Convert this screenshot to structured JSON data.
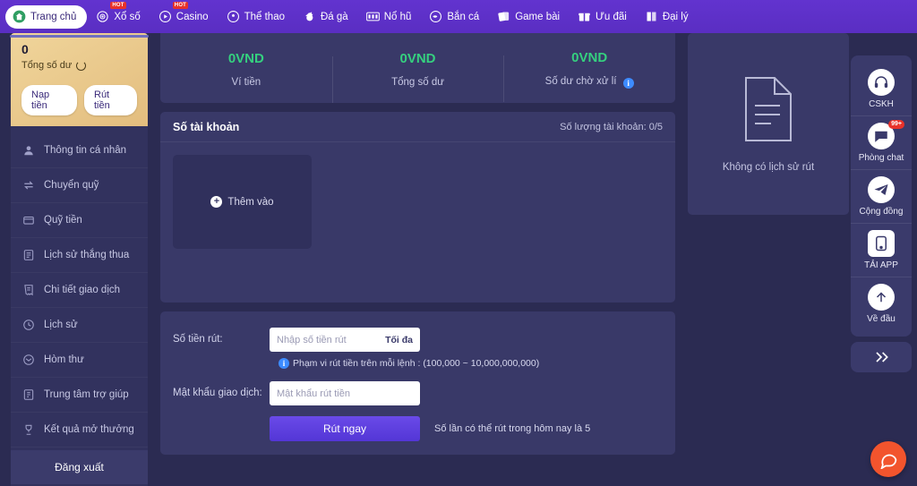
{
  "topnav": {
    "items": [
      {
        "label": "Trang chủ",
        "icon": "home-icon",
        "active": true,
        "badge": ""
      },
      {
        "label": "Xổ số",
        "icon": "target-icon",
        "active": false,
        "badge": "HOT"
      },
      {
        "label": "Casino",
        "icon": "play-circle-icon",
        "active": false,
        "badge": "HOT"
      },
      {
        "label": "Thể thao",
        "icon": "soccer-ball-icon",
        "active": false,
        "badge": ""
      },
      {
        "label": "Đá gà",
        "icon": "rooster-icon",
        "active": false,
        "badge": ""
      },
      {
        "label": "Nổ hũ",
        "icon": "slot-machine-icon",
        "active": false,
        "badge": ""
      },
      {
        "label": "Bắn cá",
        "icon": "fish-icon",
        "active": false,
        "badge": ""
      },
      {
        "label": "Game bài",
        "icon": "cards-icon",
        "active": false,
        "badge": ""
      },
      {
        "label": "Ưu đãi",
        "icon": "gift-icon",
        "active": false,
        "badge": ""
      },
      {
        "label": "Đại lý",
        "icon": "book-icon",
        "active": false,
        "badge": ""
      }
    ]
  },
  "sidebar": {
    "wallet": {
      "amount": "0",
      "label": "Tổng số dư",
      "refresh_icon": "refresh-icon",
      "deposit_label": "Nạp tiền",
      "withdraw_label": "Rút tiền"
    },
    "items": [
      {
        "label": "Thông tin cá nhân",
        "icon": "user-icon"
      },
      {
        "label": "Chuyển quỹ",
        "icon": "transfer-icon"
      },
      {
        "label": "Quỹ tiền",
        "icon": "wallet-icon"
      },
      {
        "label": "Lịch sử thắng thua",
        "icon": "list-icon"
      },
      {
        "label": "Chi tiết giao dịch",
        "icon": "receipt-icon"
      },
      {
        "label": "Lịch sử",
        "icon": "clock-icon"
      },
      {
        "label": "Hòm thư",
        "icon": "mail-icon"
      },
      {
        "label": "Trung tâm trợ giúp",
        "icon": "help-icon"
      },
      {
        "label": "Kết quả mở thưởng",
        "icon": "trophy-icon"
      }
    ],
    "logout_label": "Đăng xuất",
    "logo_name": "mmo-casino-logo"
  },
  "balance_strip": {
    "columns": [
      {
        "value": "0VND",
        "label": "Ví tiền",
        "info": false
      },
      {
        "value": "0VND",
        "label": "Tổng số dư",
        "info": false
      },
      {
        "value": "0VND",
        "label": "Số dư chờ xử lí",
        "info": true
      }
    ]
  },
  "account_panel": {
    "title": "Số tài khoản",
    "count_label": "Số lượng tài khoản:",
    "count_value": "0/5",
    "add_label": "Thêm vào",
    "add_icon": "plus-circle-icon"
  },
  "withdraw_form": {
    "amount_label": "Số tiền rút:",
    "amount_placeholder": "Nhập số tiền rút",
    "max_label": "Tối đa",
    "hint_icon": "info-icon",
    "hint": "Phạm vi rút tiền trên mỗi lệnh : (100,000 ~ 10,000,000,000)",
    "password_label": "Mật khẩu giao dịch:",
    "password_placeholder": "Mật khẩu rút tiền",
    "submit_label": "Rút ngay",
    "limit_note": "Số lần có thể rút trong hôm nay là 5"
  },
  "history_panel": {
    "icon": "document-icon",
    "empty_text": "Không có lịch sử rút"
  },
  "rail": {
    "items": [
      {
        "label": "CSKH",
        "icon": "headset-icon",
        "badge": "",
        "shape": "circle"
      },
      {
        "label": "Phòng chat",
        "icon": "chat-icon",
        "badge": "99+",
        "shape": "circle"
      },
      {
        "label": "Cộng đồng",
        "icon": "telegram-icon",
        "badge": "",
        "shape": "circle"
      },
      {
        "label": "TẢI APP",
        "icon": "phone-icon",
        "badge": "",
        "shape": "square"
      },
      {
        "label": "Về đầu",
        "icon": "arrow-up-icon",
        "badge": "",
        "shape": "circle"
      }
    ],
    "collapse_icon": "chevron-double-right-icon",
    "chat_icon": "chat-bubble-icon"
  },
  "colors": {
    "nav_purple": "#5b2fc9",
    "panel": "#393968",
    "page_bg": "#2b2b52",
    "green": "#35d07f",
    "wallet_gold": "#e8c889",
    "accent_button": "#5a42e0",
    "badge_red": "#e8322a",
    "chat_orange": "#f2542d"
  }
}
